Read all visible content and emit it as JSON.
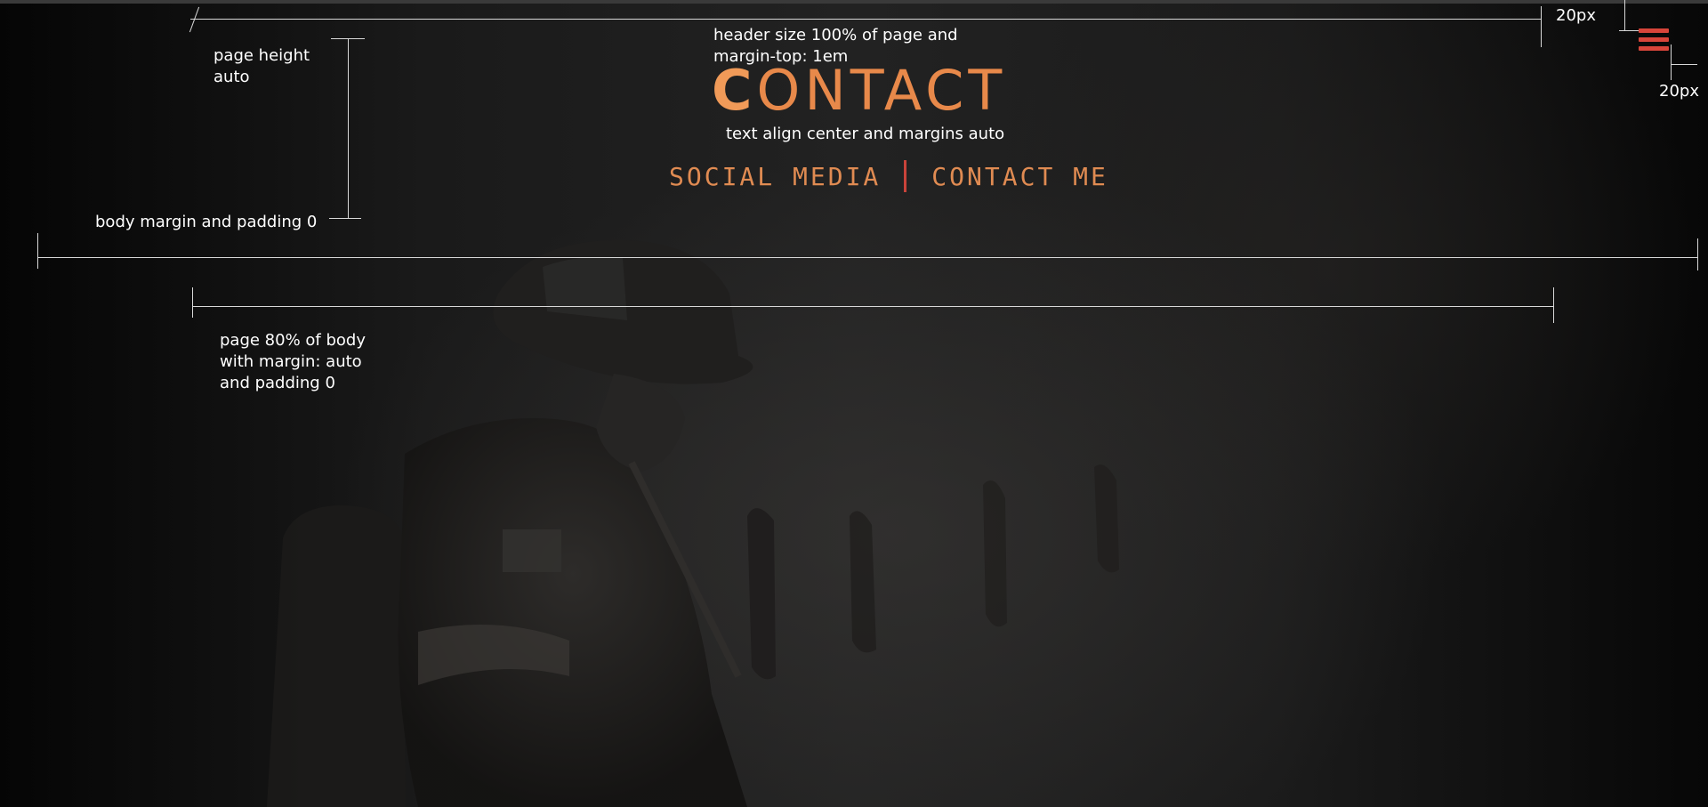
{
  "header": {
    "title_first_letter": "C",
    "title_rest": "ONTACT"
  },
  "nav": {
    "items": [
      {
        "label": "SOCIAL MEDIA"
      },
      {
        "label": "CONTACT ME"
      }
    ]
  },
  "annotations": {
    "header_note": "header size 100% of page and\nmargin-top: 1em",
    "text_align_note": "text align center and margins auto",
    "page_height_note": "page height\nauto",
    "body_margin_note": "body margin and padding 0",
    "page_width_note": "page 80% of body\nwith margin: auto\nand padding 0",
    "top_offset_note": "20px",
    "right_offset_note": "20px"
  },
  "colors": {
    "accent_orange": "#e8894a",
    "menu_red": "#d8453a",
    "separator_red": "#c9433a"
  },
  "icons": {
    "menu": "hamburger-menu-icon"
  }
}
